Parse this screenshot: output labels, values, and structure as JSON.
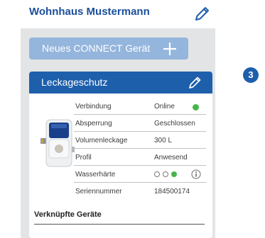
{
  "header": {
    "title": "Wohnhaus Mustermann",
    "edit_icon": "pencil-icon"
  },
  "new_device_button": {
    "label": "Neues CONNECT Gerät",
    "icon": "plus-icon"
  },
  "card": {
    "title": "Leckageschutz",
    "edit_icon": "pencil-icon",
    "device_image": "leak-protection-device",
    "properties": [
      {
        "label": "Verbindung",
        "value": "Online",
        "status_color": "#46b649"
      },
      {
        "label": "Absperrung",
        "value": "Geschlossen"
      },
      {
        "label": "Volumenleckage",
        "value": "300 L"
      },
      {
        "label": "Profil",
        "value": "Anwesend"
      },
      {
        "label": "Wasserhärte",
        "value": "",
        "level": 3,
        "level_max": 3,
        "active_color": "#46b649",
        "icon": "info-icon"
      },
      {
        "label": "Seriennummer",
        "value": "184500174"
      }
    ],
    "linked_devices_label": "Verknüpfte Geräte"
  },
  "step_badge": "3",
  "colors": {
    "brand_blue": "#1e5fac",
    "light_blue": "#94b5dc",
    "panel_gray": "#e3e4e5",
    "status_green": "#46b649"
  }
}
